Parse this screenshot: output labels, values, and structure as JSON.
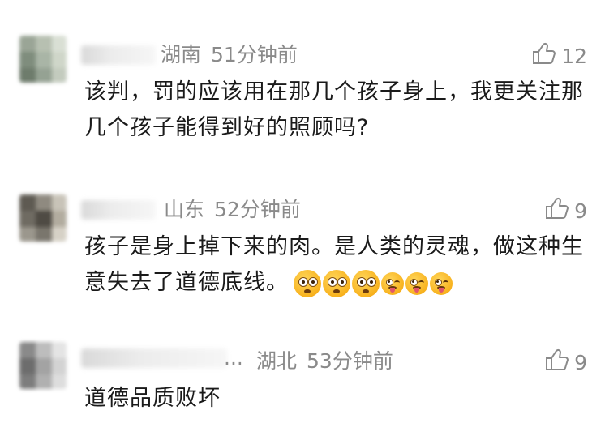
{
  "comments": [
    {
      "location": "湖南",
      "location_visible": "湖南",
      "time": "51分钟前",
      "likes": "12",
      "text": "该判，罚的应该用在那几个孩子身上，我更关注那几个孩子能得到好的照顾吗?"
    },
    {
      "location": "山东",
      "time": "52分钟前",
      "likes": "9",
      "text": "孩子是身上掉下来的肉。是人类的灵魂，做这种生意失去了道德底线。",
      "emojis": [
        "flushed-face",
        "flushed-face",
        "flushed-face",
        "winking-tongue-face",
        "winking-tongue-face",
        "winking-tongue-face"
      ]
    },
    {
      "location": "湖北",
      "time": "53分钟前",
      "likes": "9",
      "name_suffix": "...",
      "text": "道德品质败坏"
    }
  ],
  "icons": {
    "like": "thumbs-up-icon"
  },
  "colors": {
    "meta_text": "#8a8a8a",
    "body_text": "#1a1a1a",
    "background": "#ffffff"
  }
}
